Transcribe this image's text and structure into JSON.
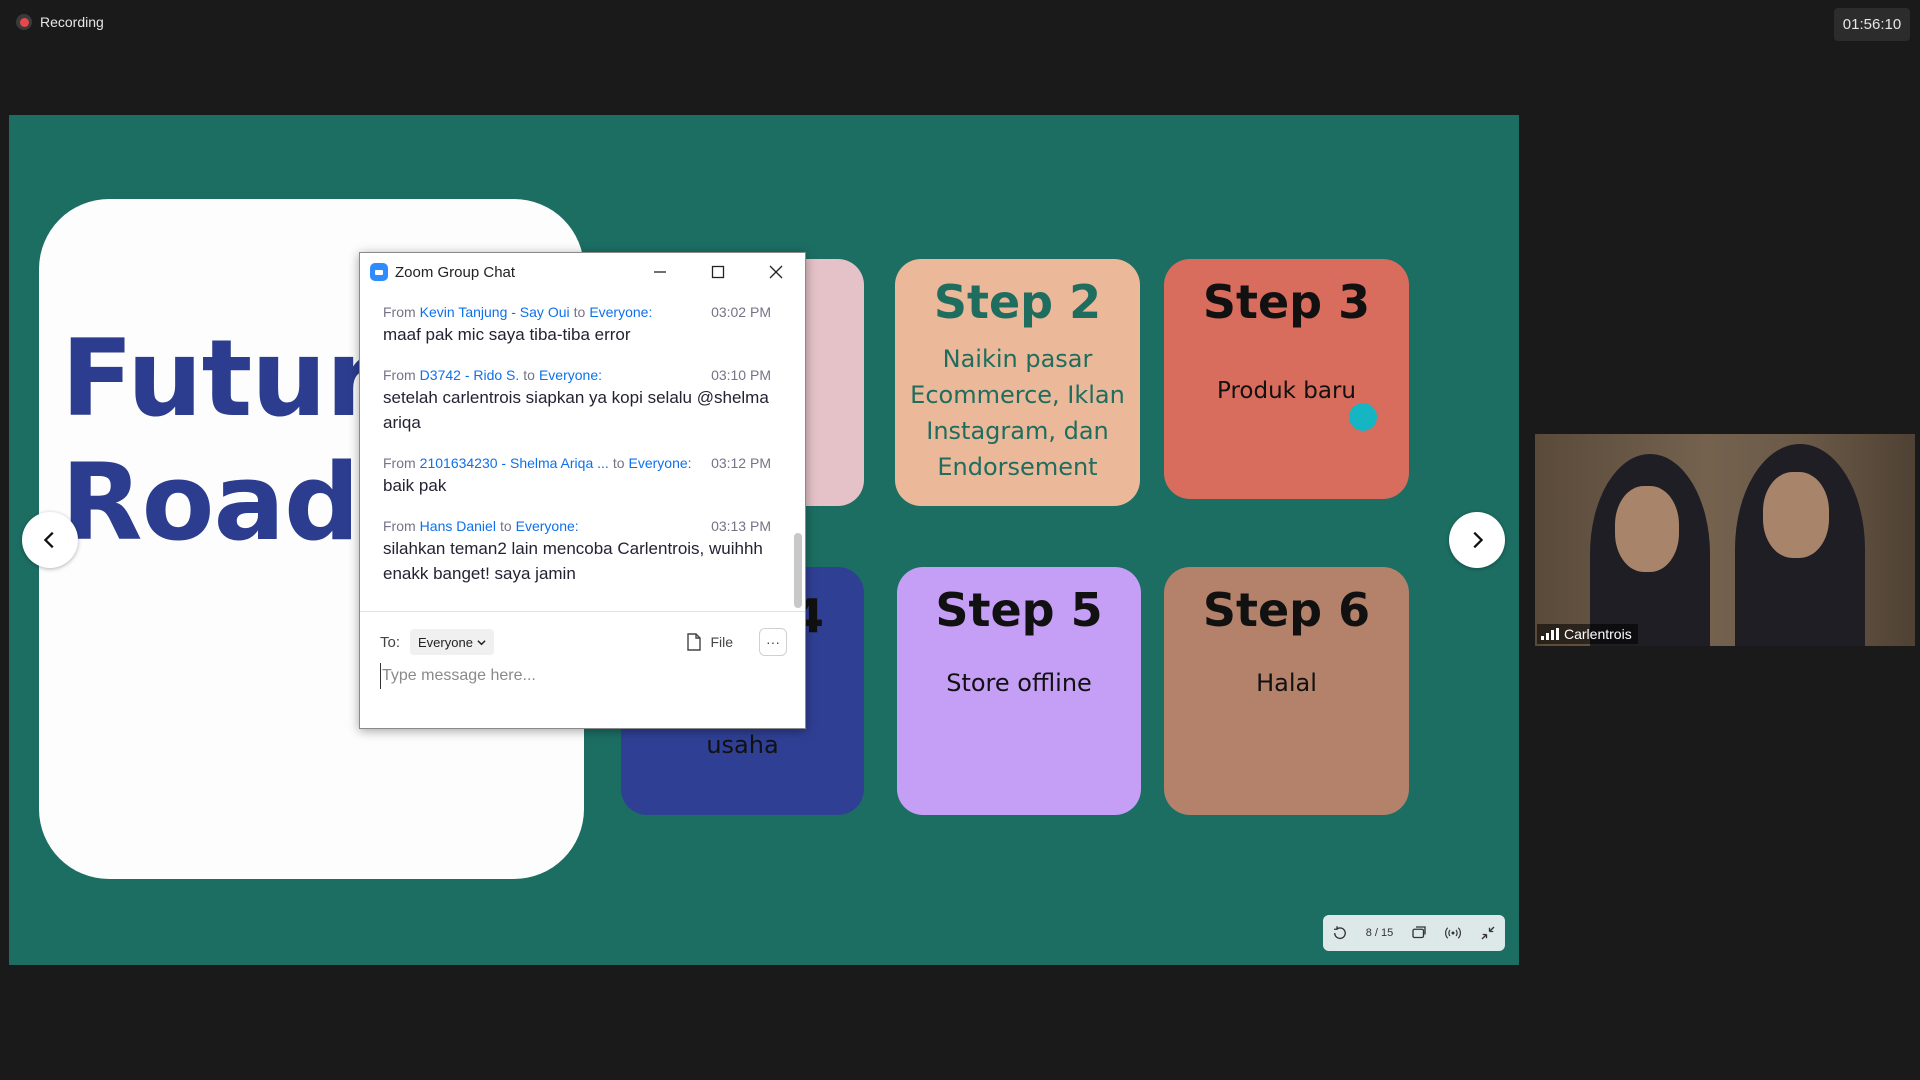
{
  "recording": {
    "label": "Recording"
  },
  "timer": "01:56:10",
  "slide": {
    "title_line1": "Future",
    "title_line2": "Roadr",
    "steps": [
      {
        "title": "",
        "desc": ""
      },
      {
        "title": "Step 2",
        "desc": "Naikin pasar Ecommerce, Iklan Instagram, dan Endorsement"
      },
      {
        "title": "Step 3",
        "desc": "Produk baru"
      },
      {
        "title": "4",
        "desc": "usaha"
      },
      {
        "title": "Step 5",
        "desc": "Store offline"
      },
      {
        "title": "Step 6",
        "desc": "Halal"
      }
    ],
    "page_indicator": "8 / 15"
  },
  "chat": {
    "title": "Zoom Group Chat",
    "messages": [
      {
        "from_label": "From",
        "sender": "Kevin Tanjung - Say Oui",
        "to_label": "to",
        "recipient": "Everyone:",
        "time": "03:02 PM",
        "text": "maaf pak mic saya tiba-tiba error"
      },
      {
        "from_label": "From",
        "sender": "D3742 - Rido S.",
        "to_label": "to",
        "recipient": "Everyone:",
        "time": "03:10 PM",
        "text": "setelah carlentrois siapkan ya kopi selalu @shelma ariqa"
      },
      {
        "from_label": "From",
        "sender": "2101634230 - Shelma Ariqa ...",
        "to_label": "to",
        "recipient": "Everyone:",
        "time": "03:12 PM",
        "text": "baik pak"
      },
      {
        "from_label": "From",
        "sender": "Hans Daniel",
        "to_label": "to",
        "recipient": "Everyone:",
        "time": "03:13 PM",
        "text": "silahkan teman2 lain mencoba Carlentrois, wuihhh enakk banget! saya jamin"
      }
    ],
    "to_label": "To:",
    "recipient_select": "Everyone",
    "file_label": "File",
    "more_label": "···",
    "input_placeholder": "Type message here..."
  },
  "video": {
    "participant_name": "Carlentrois"
  },
  "colors": {
    "stage_bg": "#1c6e63",
    "link_blue": "#0e71eb",
    "pointer": "#16b5c3"
  }
}
